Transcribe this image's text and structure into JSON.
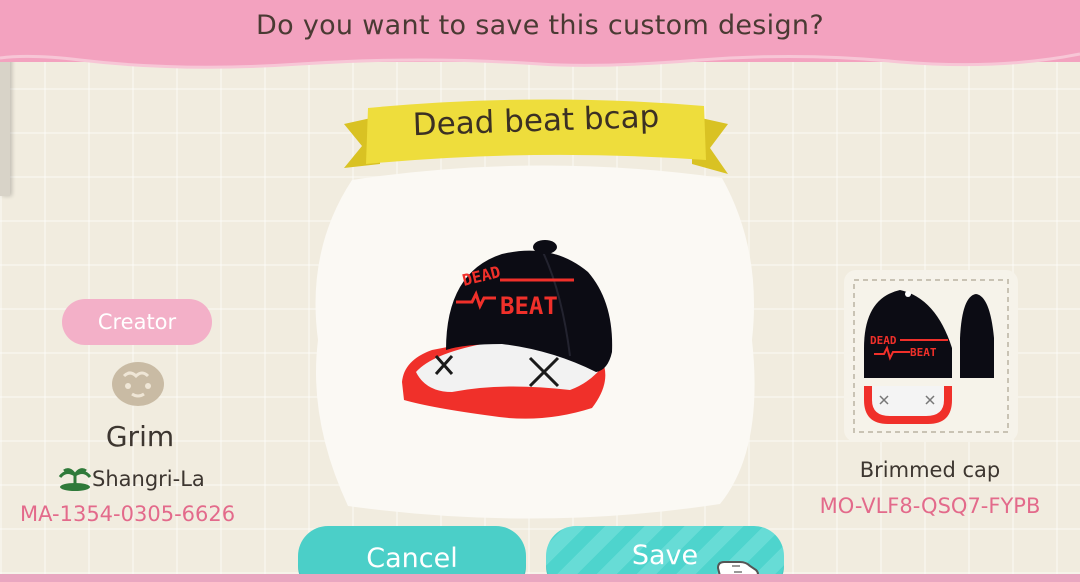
{
  "dialog": {
    "prompt": "Do you want to save this custom design?"
  },
  "design": {
    "title": "Dead beat bcap",
    "cap_text_top": "DEAD",
    "cap_text_bottom": "BEAT",
    "item_type": "Brimmed cap",
    "design_code": "MO-VLF8-QSQ7-FYPB"
  },
  "creator": {
    "label": "Creator",
    "name": "Grim",
    "island": "Shangri-La",
    "code": "MA-1354-0305-6626"
  },
  "buttons": {
    "cancel_label": "Cancel",
    "save_label": "Save"
  },
  "icons": {
    "avatar": "villager-face-icon",
    "island": "island-palm-icon",
    "cursor": "pointing-hand-cursor-icon"
  },
  "colors": {
    "banner_pink": "#f3a2bf",
    "accent_pink_text": "#e36a8b",
    "button_teal": "#4bcfc8",
    "ribbon_yellow": "#eedd3c",
    "cap_black": "#0c0c14",
    "cap_red": "#f0302a"
  }
}
